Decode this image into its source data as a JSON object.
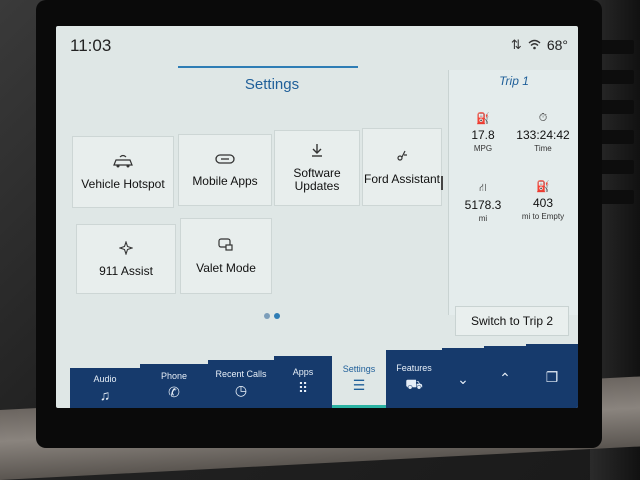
{
  "status": {
    "time": "11:03",
    "temperature": "68°",
    "icons": [
      "data-transfer-icon",
      "wifi-icon"
    ]
  },
  "settings": {
    "title": "Settings",
    "tiles": [
      {
        "label": "Vehicle Hotspot",
        "icon": "car-wifi-icon"
      },
      {
        "label": "Mobile Apps",
        "icon": "link-icon"
      },
      {
        "label": "Software Updates",
        "icon": "download-icon"
      },
      {
        "label": "Ford Assistant",
        "icon": "assistant-icon"
      },
      {
        "label": "911 Assist",
        "icon": "emergency-icon"
      },
      {
        "label": "Valet Mode",
        "icon": "valet-lock-icon"
      }
    ],
    "page_indicator": {
      "pages": 2,
      "current": 2
    }
  },
  "trip": {
    "title": "Trip 1",
    "stats": [
      {
        "value": "17.8",
        "label": "MPG",
        "icon": "fuel-economy-icon"
      },
      {
        "value": "133:24:42",
        "label": "Time",
        "icon": "stopwatch-icon"
      },
      {
        "value": "5178.3",
        "label": "mi",
        "icon": "road-icon"
      },
      {
        "value": "403",
        "label": "mi to Empty",
        "icon": "fuel-pump-icon"
      }
    ],
    "switch_label": "Switch to Trip 2"
  },
  "nav": [
    {
      "label": "Audio",
      "icon": "music-note-icon"
    },
    {
      "label": "Phone",
      "icon": "phone-icon"
    },
    {
      "label": "Recent Calls",
      "icon": "recent-calls-icon"
    },
    {
      "label": "Apps",
      "icon": "apps-grid-icon"
    },
    {
      "label": "Settings",
      "icon": "sliders-icon",
      "active": true
    },
    {
      "label": "Features",
      "icon": "truck-icon"
    },
    {
      "label": "",
      "icon": "chevron-down-icon"
    },
    {
      "label": "",
      "icon": "chevron-up-icon"
    },
    {
      "label": "",
      "icon": "windows-icon"
    }
  ],
  "colors": {
    "accent": "#1f5f99",
    "nav_bg": "#163a6c",
    "active_underline": "#2bb3a3",
    "screen_bg": "#dfe7e6"
  }
}
